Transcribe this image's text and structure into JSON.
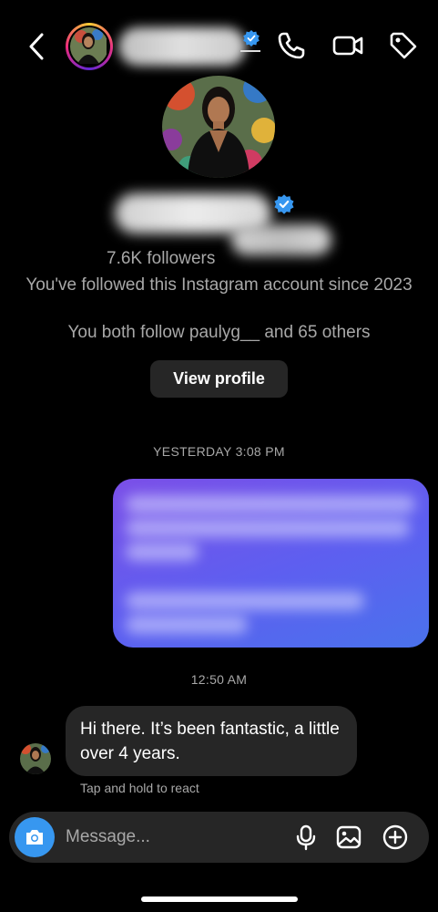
{
  "header": {
    "back_icon": "chevron-left-icon",
    "call_icon": "phone-icon",
    "video_icon": "video-camera-icon",
    "tag_icon": "tag-icon",
    "verified_color": "#3797f0"
  },
  "profile": {
    "followers": "7.6K followers",
    "since": "You've followed this Instagram account since 2023",
    "mutual": "You both follow paulyg__ and 65 others",
    "view_profile_label": "View profile"
  },
  "thread": {
    "timestamp_1": "YESTERDAY 3:08 PM",
    "timestamp_2": "12:50 AM",
    "received_message": "Hi there. It’s been fantastic, a little over 4 years.",
    "react_hint": "Tap and hold to react",
    "sent_bubble_color": "#5d5ff0"
  },
  "composer": {
    "placeholder": "Message...",
    "camera_icon": "camera-icon",
    "mic_icon": "microphone-icon",
    "gallery_icon": "image-icon",
    "add_icon": "plus-circle-icon",
    "accent": "#3797f0"
  }
}
